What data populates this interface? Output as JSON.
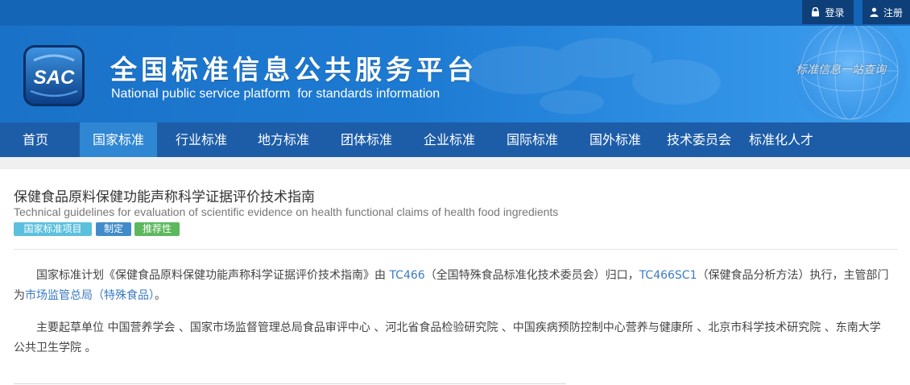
{
  "header": {
    "login_label": "登录",
    "register_label": "注册",
    "logo_text": "SAC",
    "title": "全国标准信息公共服务平台",
    "subtitle": "National public service platform  for standards information",
    "slogan": "标准信息一站查询"
  },
  "nav": {
    "items": [
      {
        "label": "首页"
      },
      {
        "label": "国家标准"
      },
      {
        "label": "行业标准"
      },
      {
        "label": "地方标准"
      },
      {
        "label": "团体标准"
      },
      {
        "label": "企业标准"
      },
      {
        "label": "国际标准"
      },
      {
        "label": "国外标准"
      },
      {
        "label": "技术委员会"
      },
      {
        "label": "标准化人才"
      }
    ],
    "active": "国家标准"
  },
  "standard": {
    "title": "保健食品原料保健功能声称科学证据评价技术指南",
    "title_en": "Technical guidelines for evaluation of scientific evidence on health functional claims of health food ingredients",
    "tags": [
      {
        "label": "国家标准项目",
        "color": "#5bc0de"
      },
      {
        "label": "制定",
        "color": "#428bca"
      },
      {
        "label": "推荐性",
        "color": "#5cb85c"
      }
    ],
    "plan": {
      "prefix": "国家标准计划《保健食品原料保健功能声称科学证据评价技术指南》由 ",
      "tc": "TC466",
      "tc_name": "（全国特殊食品标准化技术委员会）归口，",
      "sc": "TC466SC1",
      "sc_name": "（保健食品分析方法）执行，主管部门为",
      "authority": "市场监管总局（特殊食品）",
      "suffix": "。"
    },
    "drafters": "主要起草单位 中国营养学会 、国家市场监督管理总局食品审评中心 、河北省食品检验研究院 、中国疾病预防控制中心营养与健康所 、北京市科学技术研究院 、东南大学公共卫生学院 。"
  },
  "colors": {
    "topbar": "#1565b7",
    "top_button": "#0e3f78",
    "nav": "#1d5da8",
    "nav_active": "#2f86d3",
    "link": "#3b7bc2"
  }
}
